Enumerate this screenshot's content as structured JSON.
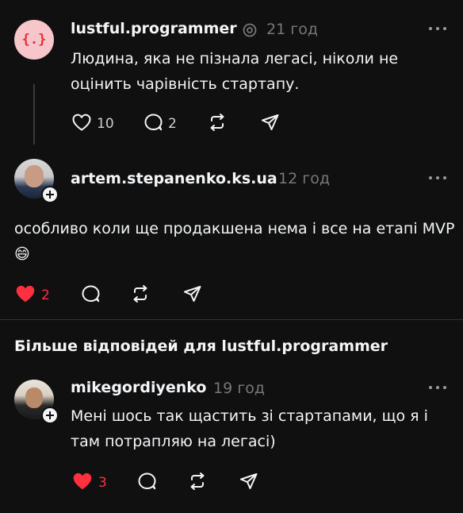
{
  "colors": {
    "background": "#101010",
    "text": "#f3f5f7",
    "muted": "#777777",
    "like_active": "#ff3040",
    "logo_accent": "#e0303e"
  },
  "posts": [
    {
      "username": "lustful.programmer",
      "verified_icon": "threads-badge-icon",
      "time": "21 год",
      "body": "Людина, яка не пізнала легасі, ніколи не оцінить чарівність стартапу.",
      "avatar_text": "{.}",
      "likes": "10",
      "replies": "2",
      "liked": false
    },
    {
      "username": "artem.stepanenko.ks.ua",
      "time": "12 год",
      "body": "особливо коли ще продакшена нема і все на етапі MVP 😄",
      "likes": "2",
      "liked": true
    }
  ],
  "more_replies": {
    "title": "Більше відповідей для lustful.programmer"
  },
  "reply": {
    "username": "mikegordiyenko",
    "time": "19 год",
    "body": "Мені шось так щастить зі стартапами, що я і там потрапляю на легасі)",
    "likes": "3",
    "liked": true
  }
}
